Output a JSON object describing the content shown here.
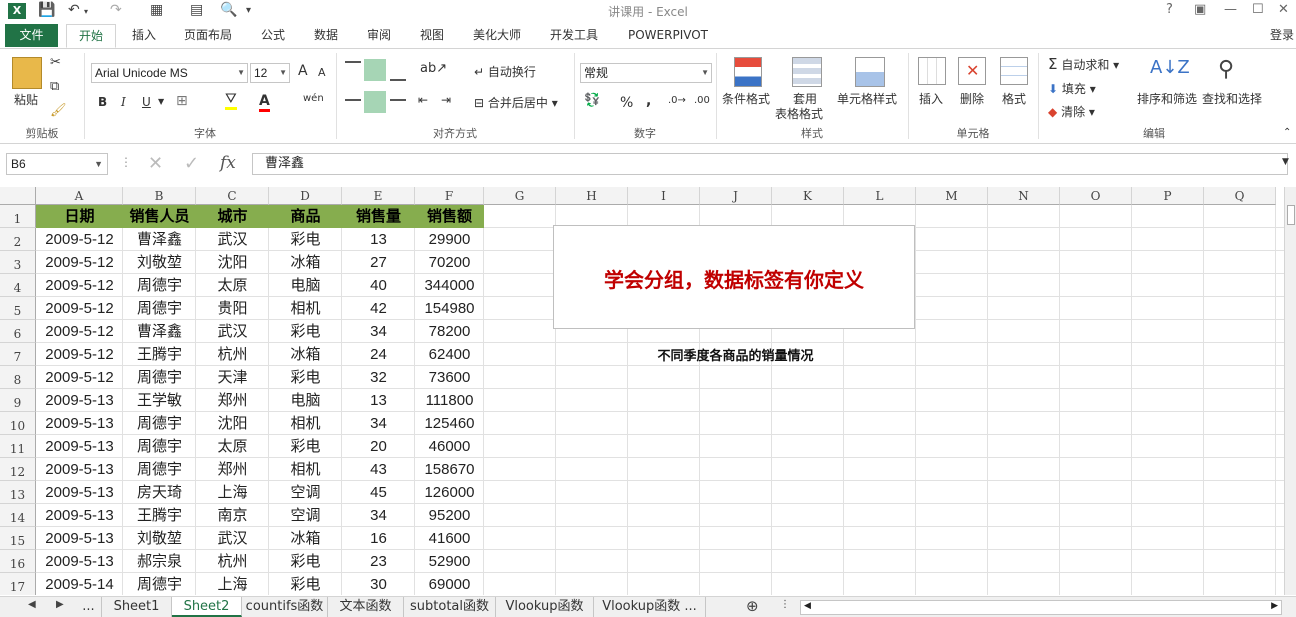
{
  "window": {
    "title": "讲课用 - Excel",
    "help": "?",
    "minimize": "—",
    "maximize": "☐",
    "close": "✕",
    "ribbon_display": "▣",
    "login": "登录"
  },
  "tabs": [
    "文件",
    "开始",
    "插入",
    "页面布局",
    "公式",
    "数据",
    "审阅",
    "视图",
    "美化大师",
    "开发工具",
    "POWERPIVOT"
  ],
  "ribbon": {
    "clipboard": {
      "paste": "粘贴",
      "label": "剪贴板"
    },
    "font": {
      "name": "Arial Unicode MS",
      "size": "12",
      "bold": "B",
      "italic": "I",
      "underline": "U",
      "grow": "A",
      "shrink": "A",
      "phonetic": "wén",
      "label": "字体"
    },
    "align": {
      "wrap": "自动换行",
      "merge": "合并后居中",
      "label": "对齐方式"
    },
    "number": {
      "format": "常规",
      "percent": "%",
      "comma": ",",
      "label": "数字"
    },
    "styles": {
      "cond": "条件格式",
      "table1": "套用",
      "table2": "表格格式",
      "cell": "单元格样式",
      "label": "样式"
    },
    "cells": {
      "insert": "插入",
      "delete": "删除",
      "format": "格式",
      "label": "单元格"
    },
    "edit": {
      "autosum": "自动求和",
      "fill": "填充",
      "clear": "清除",
      "sort": "排序和筛选",
      "find": "查找和选择",
      "label": "编辑"
    }
  },
  "formula_bar": {
    "cell_ref": "B6",
    "fx": "fx",
    "value": "曹泽鑫"
  },
  "columns": [
    "A",
    "B",
    "C",
    "D",
    "E",
    "F",
    "G",
    "H",
    "I",
    "J",
    "K",
    "L",
    "M",
    "N",
    "O",
    "P",
    "Q"
  ],
  "rows": [
    "1",
    "2",
    "3",
    "4",
    "5",
    "6",
    "7",
    "8",
    "9",
    "10",
    "11",
    "12",
    "13",
    "14",
    "15",
    "16",
    "17"
  ],
  "table": {
    "headers": [
      "日期",
      "销售人员",
      "城市",
      "商品",
      "销售量",
      "销售额"
    ],
    "data": [
      [
        "2009-5-12",
        "曹泽鑫",
        "武汉",
        "彩电",
        "13",
        "29900"
      ],
      [
        "2009-5-12",
        "刘敬堃",
        "沈阳",
        "冰箱",
        "27",
        "70200"
      ],
      [
        "2009-5-12",
        "周德宇",
        "太原",
        "电脑",
        "40",
        "344000"
      ],
      [
        "2009-5-12",
        "周德宇",
        "贵阳",
        "相机",
        "42",
        "154980"
      ],
      [
        "2009-5-12",
        "曹泽鑫",
        "武汉",
        "彩电",
        "34",
        "78200"
      ],
      [
        "2009-5-12",
        "王腾宇",
        "杭州",
        "冰箱",
        "24",
        "62400"
      ],
      [
        "2009-5-12",
        "周德宇",
        "天津",
        "彩电",
        "32",
        "73600"
      ],
      [
        "2009-5-13",
        "王学敏",
        "郑州",
        "电脑",
        "13",
        "111800"
      ],
      [
        "2009-5-13",
        "周德宇",
        "沈阳",
        "相机",
        "34",
        "125460"
      ],
      [
        "2009-5-13",
        "周德宇",
        "太原",
        "彩电",
        "20",
        "46000"
      ],
      [
        "2009-5-13",
        "周德宇",
        "郑州",
        "相机",
        "43",
        "158670"
      ],
      [
        "2009-5-13",
        "房天琦",
        "上海",
        "空调",
        "45",
        "126000"
      ],
      [
        "2009-5-13",
        "王腾宇",
        "南京",
        "空调",
        "34",
        "95200"
      ],
      [
        "2009-5-13",
        "刘敬堃",
        "武汉",
        "冰箱",
        "16",
        "41600"
      ],
      [
        "2009-5-13",
        "郝宗泉",
        "杭州",
        "彩电",
        "23",
        "52900"
      ],
      [
        "2009-5-14",
        "周德宇",
        "上海",
        "彩电",
        "30",
        "69000"
      ]
    ]
  },
  "overlay": {
    "title": "学会分组，数据标签有你定义",
    "subtitle": "不同季度各商品的销量情况"
  },
  "sheets": [
    "...",
    "Sheet1",
    "Sheet2",
    "countifs函数",
    "文本函数",
    "subtotal函数",
    "Vlookup函数",
    "Vlookup函数 ..."
  ],
  "active_sheet": "Sheet2",
  "colors": {
    "excel_green": "#217346",
    "header_fill": "#86ad4e",
    "title_red": "#c00000"
  }
}
